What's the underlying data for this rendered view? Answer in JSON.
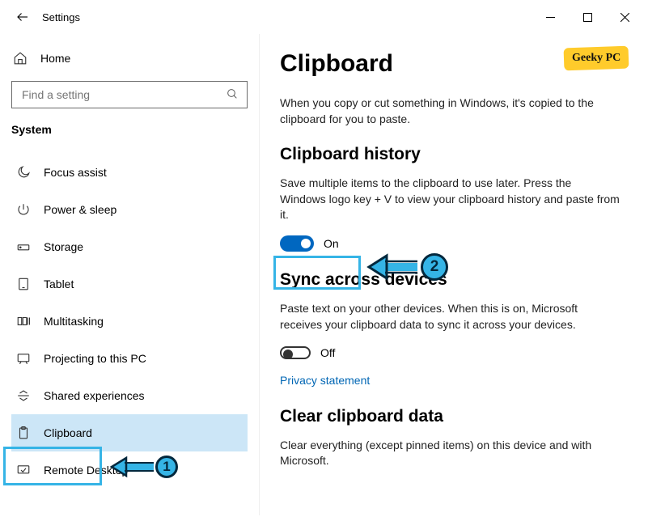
{
  "window": {
    "title": "Settings"
  },
  "sidebar": {
    "home_label": "Home",
    "search_placeholder": "Find a setting",
    "section_title": "System",
    "items": [
      {
        "label": "Focus assist"
      },
      {
        "label": "Power & sleep"
      },
      {
        "label": "Storage"
      },
      {
        "label": "Tablet"
      },
      {
        "label": "Multitasking"
      },
      {
        "label": "Projecting to this PC"
      },
      {
        "label": "Shared experiences"
      },
      {
        "label": "Clipboard"
      },
      {
        "label": "Remote Desktop"
      }
    ]
  },
  "main": {
    "title": "Clipboard",
    "intro": "When you copy or cut something in Windows, it's copied to the clipboard for you to paste.",
    "history": {
      "heading": "Clipboard history",
      "desc": "Save multiple items to the clipboard to use later. Press the Windows logo key + V to view your clipboard history and paste from it.",
      "toggle_label": "On"
    },
    "sync": {
      "heading": "Sync across devices",
      "desc": "Paste text on your other devices. When this is on, Microsoft receives your clipboard data to sync it across your devices.",
      "toggle_label": "Off",
      "privacy_link": "Privacy statement"
    },
    "clear": {
      "heading": "Clear clipboard data",
      "desc": "Clear everything (except pinned items) on this device and with Microsoft."
    }
  },
  "brand": {
    "text": "Geeky PC"
  },
  "annotations": {
    "a1": "1",
    "a2": "2"
  }
}
